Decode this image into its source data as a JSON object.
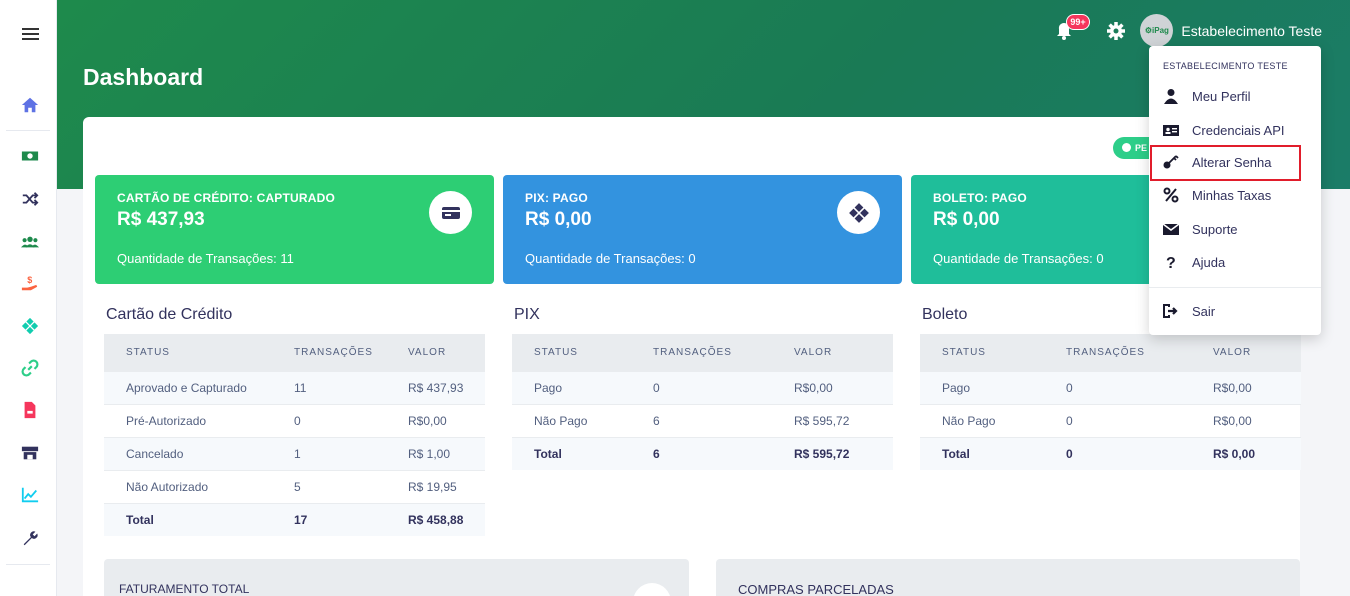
{
  "header": {
    "page_title": "Dashboard",
    "notification_badge": "99+",
    "user_name": "Estabelecimento Teste",
    "avatar_text": "⚙iPag",
    "period_pill": "PE"
  },
  "colors": {
    "header_green": "#1e8a4c",
    "credit_green": "#2dce89",
    "pix_blue": "#3393df",
    "boleto_teal": "#1fbe9a",
    "highlight_red": "#e11d2b"
  },
  "stats": [
    {
      "title": "CARTÃO DE CRÉDITO: CAPTURADO",
      "value": "R$ 437,93",
      "sub": "Quantidade de Transações: 11",
      "icon": "credit-card-icon"
    },
    {
      "title": "PIX: PAGO",
      "value": "R$ 0,00",
      "sub": "Quantidade de Transações: 0",
      "icon": "pix-icon"
    },
    {
      "title": "BOLETO: PAGO",
      "value": "R$ 0,00",
      "sub": "Quantidade de Transações: 0",
      "icon": "barcode-icon"
    }
  ],
  "tables": {
    "credit": {
      "title": "Cartão de Crédito",
      "headers": [
        "STATUS",
        "TRANSAÇÕES",
        "VALOR"
      ],
      "rows": [
        [
          "Aprovado e Capturado",
          "11",
          "R$ 437,93"
        ],
        [
          "Pré-Autorizado",
          "0",
          "R$0,00"
        ],
        [
          "Cancelado",
          "1",
          "R$ 1,00"
        ],
        [
          "Não Autorizado",
          "5",
          "R$ 19,95"
        ],
        [
          "Total",
          "17",
          "R$ 458,88"
        ]
      ]
    },
    "pix": {
      "title": "PIX",
      "headers": [
        "STATUS",
        "TRANSAÇÕES",
        "VALOR"
      ],
      "rows": [
        [
          "Pago",
          "0",
          "R$0,00"
        ],
        [
          "Não Pago",
          "6",
          "R$ 595,72"
        ],
        [
          "Total",
          "6",
          "R$ 595,72"
        ]
      ]
    },
    "boleto": {
      "title": "Boleto",
      "headers": [
        "STATUS",
        "TRANSAÇÕES",
        "VALOR"
      ],
      "rows": [
        [
          "Pago",
          "0",
          "R$0,00"
        ],
        [
          "Não Pago",
          "0",
          "R$0,00"
        ],
        [
          "Total",
          "0",
          "R$ 0,00"
        ]
      ]
    }
  },
  "bottom": {
    "left_title": "FATURAMENTO TOTAL",
    "right_title": "COMPRAS PARCELADAS"
  },
  "dropdown": {
    "header": "ESTABELECIMENTO TESTE",
    "items": [
      {
        "label": "Meu Perfil",
        "icon": "user-icon"
      },
      {
        "label": "Credenciais API",
        "icon": "id-card-icon"
      },
      {
        "label": "Alterar Senha",
        "icon": "key-icon"
      },
      {
        "label": "Minhas Taxas",
        "icon": "percent-icon"
      },
      {
        "label": "Suporte",
        "icon": "envelope-icon"
      },
      {
        "label": "Ajuda",
        "icon": "question-icon"
      },
      {
        "label": "Sair",
        "icon": "sign-out-icon"
      }
    ]
  }
}
